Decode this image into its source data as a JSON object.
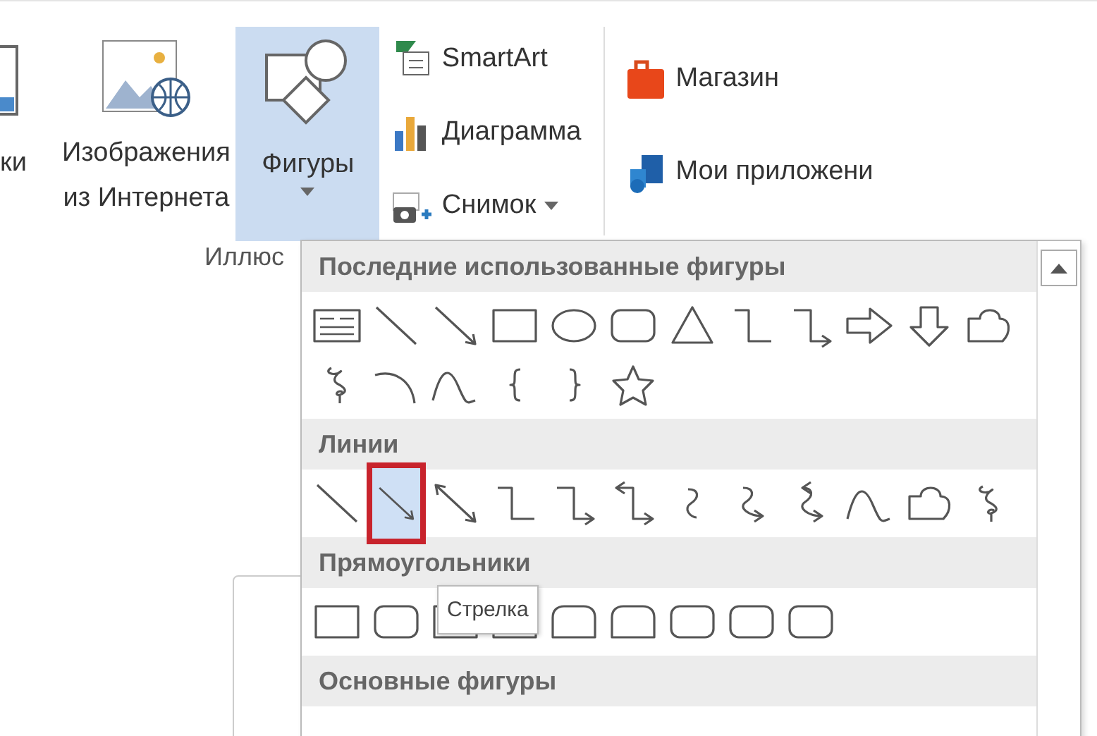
{
  "ribbon": {
    "cut_label": "ки",
    "web_images": {
      "lines": [
        "Изображения",
        "из Интернета"
      ]
    },
    "shapes_button": {
      "label": "Фигуры",
      "expanded": true
    },
    "small_buttons": [
      {
        "kind": "smartart",
        "label": "SmartArt",
        "dropdown": false
      },
      {
        "kind": "chart",
        "label": "Диаграмма",
        "dropdown": false
      },
      {
        "kind": "screenshot",
        "label": "Снимок",
        "dropdown": true
      }
    ],
    "store_buttons": [
      {
        "kind": "store",
        "label": "Магазин"
      },
      {
        "kind": "apps",
        "label": "Мои приложени"
      }
    ],
    "group_label": "Иллюс"
  },
  "shapes_menu": {
    "sections": [
      {
        "title": "Последние использованные фигуры",
        "shapes": [
          {
            "kind": "textbox",
            "selected": false
          },
          {
            "kind": "line",
            "selected": false
          },
          {
            "kind": "arrow",
            "selected": false
          },
          {
            "kind": "rect",
            "selected": false
          },
          {
            "kind": "oval",
            "selected": false
          },
          {
            "kind": "roundrect",
            "selected": false
          },
          {
            "kind": "triangle",
            "selected": false
          },
          {
            "kind": "elbow",
            "selected": false
          },
          {
            "kind": "elbow-arrow",
            "selected": false
          },
          {
            "kind": "block-right",
            "selected": false
          },
          {
            "kind": "block-down",
            "selected": false
          },
          {
            "kind": "freeform",
            "selected": false
          },
          {
            "kind": "scribble",
            "selected": false
          },
          {
            "kind": "arc",
            "selected": false
          },
          {
            "kind": "wave",
            "selected": false
          },
          {
            "kind": "left-brace",
            "selected": false
          },
          {
            "kind": "right-brace",
            "selected": false
          },
          {
            "kind": "star",
            "selected": false
          }
        ]
      },
      {
        "title": "Линии",
        "shapes": [
          {
            "kind": "line",
            "selected": false
          },
          {
            "kind": "arrow",
            "selected": true
          },
          {
            "kind": "double-arrow",
            "selected": false
          },
          {
            "kind": "elbow",
            "selected": false
          },
          {
            "kind": "elbow-arrow",
            "selected": false
          },
          {
            "kind": "elbow-double",
            "selected": false
          },
          {
            "kind": "curve",
            "selected": false
          },
          {
            "kind": "curve-arrow",
            "selected": false
          },
          {
            "kind": "curve-double",
            "selected": false
          },
          {
            "kind": "wave",
            "selected": false
          },
          {
            "kind": "freeform",
            "selected": false
          },
          {
            "kind": "scribble",
            "selected": false
          }
        ]
      },
      {
        "title": "Прямоугольники",
        "shapes": [
          {
            "kind": "rect",
            "selected": false
          },
          {
            "kind": "roundrect",
            "selected": false
          },
          {
            "kind": "snip",
            "selected": false
          },
          {
            "kind": "snip",
            "selected": false
          },
          {
            "kind": "round-top",
            "selected": false
          },
          {
            "kind": "round-top",
            "selected": false
          },
          {
            "kind": "roundrect",
            "selected": false
          },
          {
            "kind": "roundrect",
            "selected": false
          },
          {
            "kind": "roundrect",
            "selected": false
          }
        ]
      },
      {
        "title": "Основные фигуры"
      }
    ],
    "tooltip": "Стрелка"
  }
}
